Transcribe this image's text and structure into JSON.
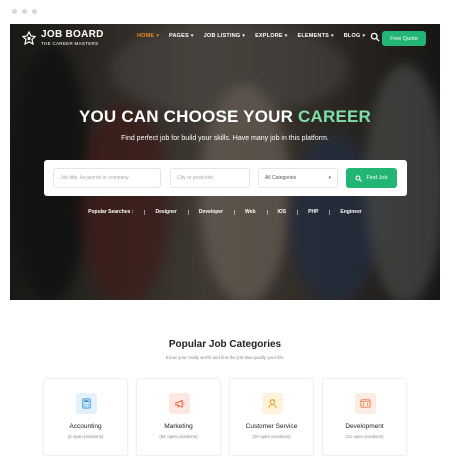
{
  "header": {
    "logo_title": "JOB BOARD",
    "logo_subtitle": "THE CAREER MASTERS",
    "menu": [
      {
        "label": "HOME",
        "active": true
      },
      {
        "label": "PAGES",
        "active": false
      },
      {
        "label": "JOB LISTING",
        "active": false
      },
      {
        "label": "EXPLORE",
        "active": false
      },
      {
        "label": "ELEMENTS",
        "active": false
      },
      {
        "label": "BLOG",
        "active": false
      }
    ],
    "quote_label": "Free Quote"
  },
  "hero": {
    "headline_prefix": "YOU CAN CHOOSE YOUR",
    "headline_accent": "CAREER",
    "subtitle": "Find perfect job for build your skills. Have many job in this platform.",
    "search": {
      "keyword_placeholder": "Job title, keywords or company",
      "location_placeholder": "City or postcode",
      "category_selected": "All Categories",
      "button_label": "Find Job"
    },
    "popular_label": "Popular Searches :",
    "popular_tags": [
      "Designer",
      "Developer",
      "Web",
      "IOS",
      "PHP",
      "Engineer"
    ]
  },
  "categories": {
    "title": "Popular Job Categories",
    "subtitle": "Know your really worth and find the job that qualify your life.",
    "items": [
      {
        "name": "Accounting",
        "count": "(2 open positions)",
        "icon": "calculator-icon",
        "bg": "#e3f1fb",
        "fg": "#2c8fd6"
      },
      {
        "name": "Marketing",
        "count": "(86 open positions)",
        "icon": "megaphone-icon",
        "bg": "#fde7e3",
        "fg": "#ef5a3c"
      },
      {
        "name": "Customer Service",
        "count": "(20 open positions)",
        "icon": "support-agent-icon",
        "bg": "#fdf3dd",
        "fg": "#e9a82a"
      },
      {
        "name": "Development",
        "count": "(12 open positions)",
        "icon": "code-window-icon",
        "bg": "#fdece3",
        "fg": "#ee7a3f"
      }
    ]
  },
  "colors": {
    "accent": "#22b573",
    "active_menu": "#f08a24"
  }
}
